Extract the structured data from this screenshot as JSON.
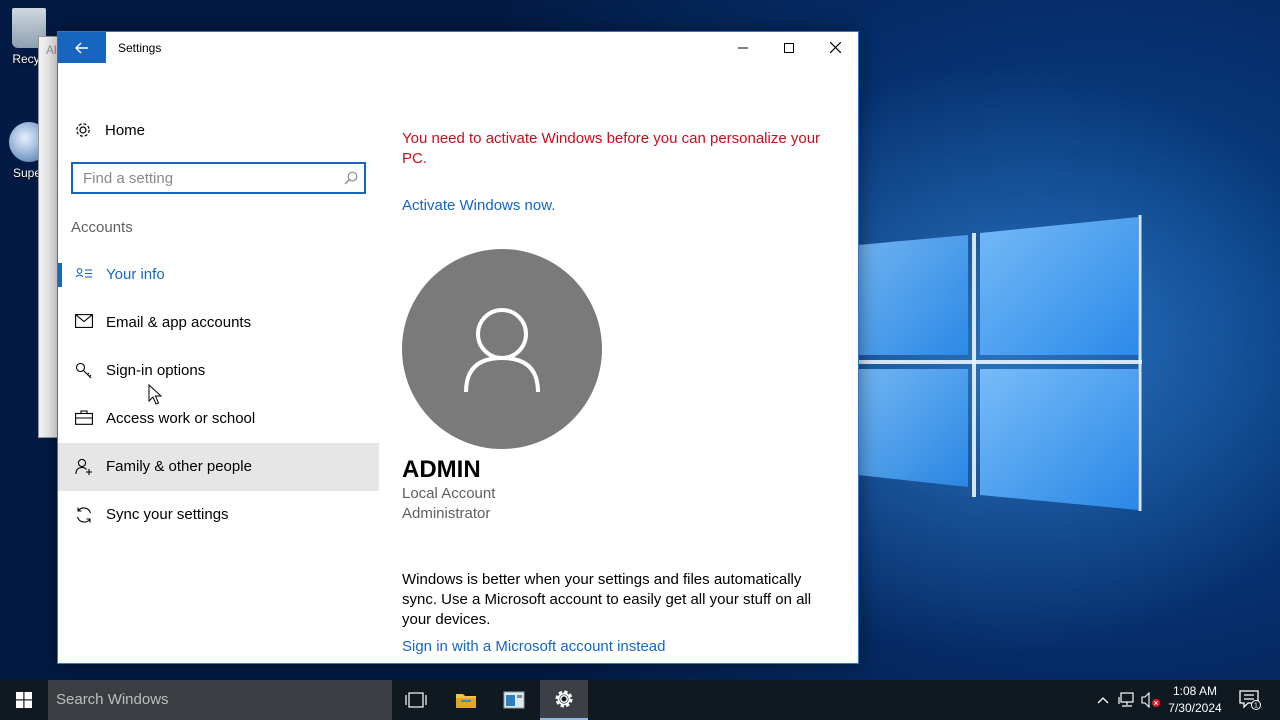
{
  "desktop": {
    "icons": [
      {
        "label": "Recyc"
      },
      {
        "label": "Super"
      }
    ],
    "behind_window_text": "Al"
  },
  "window": {
    "title": "Settings",
    "controls": {
      "minimize": "minimize-icon",
      "maximize": "maximize-icon",
      "close": "close-icon"
    }
  },
  "sidebar": {
    "home_label": "Home",
    "search": {
      "placeholder": "Find a setting",
      "value": ""
    },
    "section_title": "Accounts",
    "items": [
      {
        "label": "Your info",
        "icon": "contact-card-icon",
        "selected": true
      },
      {
        "label": "Email & app accounts",
        "icon": "mail-icon"
      },
      {
        "label": "Sign-in options",
        "icon": "key-icon"
      },
      {
        "label": "Access work or school",
        "icon": "briefcase-icon"
      },
      {
        "label": "Family & other people",
        "icon": "add-person-icon",
        "hovered": true
      },
      {
        "label": "Sync your settings",
        "icon": "sync-icon"
      }
    ]
  },
  "main": {
    "activation_warning": "You need to activate Windows before you can personalize your PC.",
    "activate_link": "Activate Windows now.",
    "user": {
      "name": "ADMIN",
      "account_type": "Local Account",
      "role": "Administrator"
    },
    "sync_message": "Windows is better when your settings and files automatically sync. Use a Microsoft account to easily get all your stuff on all your devices.",
    "ms_signin_link": "Sign in with a Microsoft account instead"
  },
  "taskbar": {
    "search_placeholder": "Search Windows",
    "clock": {
      "time": "1:08 AM",
      "date": "7/30/2024"
    },
    "notification_count": "1"
  },
  "colors": {
    "accent": "#1666c0",
    "warning": "#c50f1f",
    "hover_bg": "#e6e6e6",
    "taskbar": "#101820"
  }
}
